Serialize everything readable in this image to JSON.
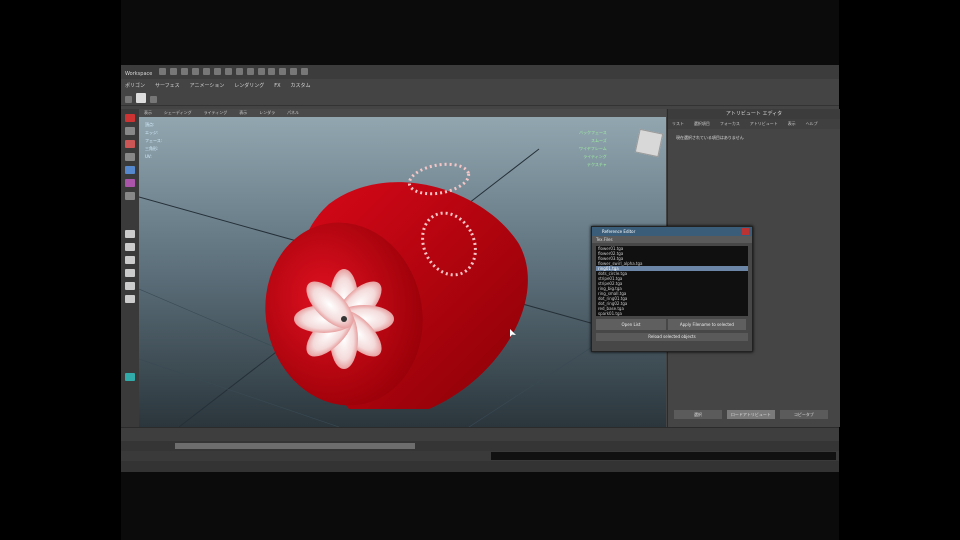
{
  "app": {
    "workspace_label": "Workspace",
    "shelf_tabs": [
      "ポリゴン",
      "サーフェス",
      "アニメーション",
      "レンダリング",
      "FX",
      "カスタム"
    ]
  },
  "viewport": {
    "menu": [
      "表示",
      "シェーディング",
      "ライティング",
      "表示",
      "レンダラ",
      "パネル"
    ],
    "hud_left": [
      "頂点:",
      "エッジ:",
      "フェース:",
      "三角形:",
      "UV:"
    ],
    "hud_right": [
      "バックフェース",
      "スムーズ",
      "ワイヤフレーム",
      "ライティング",
      "テクスチャ"
    ]
  },
  "attribute_editor": {
    "title": "アトリビュート エディタ",
    "tabs": [
      "リスト",
      "選択項目",
      "フォーカス",
      "アトリビュート",
      "表示",
      "ヘルプ"
    ],
    "message": "現在選択されている項目はありません",
    "buttons": [
      "選択",
      "ロードアトリビュート",
      "コピータブ"
    ]
  },
  "dialog": {
    "title": "Reference Editor",
    "tab": "Tex.Files",
    "items": [
      "flower01.tga",
      "flower02.tga",
      "flower03.tga",
      "flower_swirl_alpha.tga",
      "ring01.tga",
      "dots_circle.tga",
      "stripe01.tga",
      "stripe02.tga",
      "ring_big.tga",
      "ring_small.tga",
      "dot_ring01.tga",
      "dot_ring02.tga",
      "red_base.tga",
      "spark01.tga",
      "spark02.tga",
      "glow01.tga"
    ],
    "selected_index": 4,
    "btn_open": "Open List",
    "btn_apply": "Apply Filename to selected",
    "btn_reload": "Reload selected objects"
  },
  "colors": {
    "object_red": "#c40010",
    "pattern_white": "#f4e4e4",
    "dialog_title": "#3a5e7a"
  }
}
